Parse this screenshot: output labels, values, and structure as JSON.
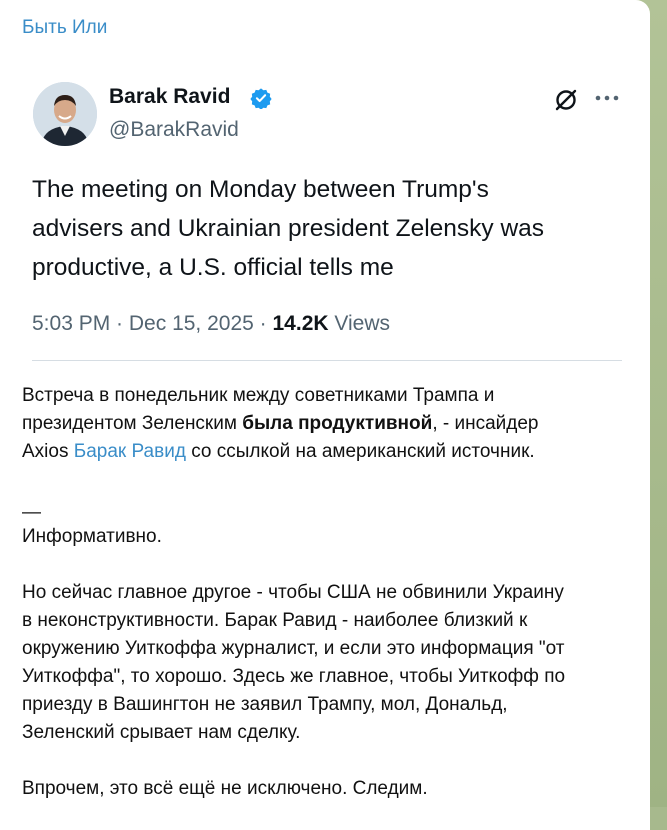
{
  "channel": {
    "name": "Быть Или"
  },
  "tweet": {
    "author_name": "Barak Ravid",
    "handle": "@BarakRavid",
    "text_lines": [
      "The meeting on Monday between Trump's",
      "advisers and Ukrainian president Zelensky was",
      "productive, a U.S. official tells me"
    ],
    "time": "5:03 PM",
    "sep1": " · ",
    "date": "Dec 15, 2025",
    "sep2": " · ",
    "views_count": "14.2K",
    "views_label": " Views"
  },
  "message": {
    "p1_line1": "Встреча в понедельник между советниками Трампа и",
    "p1_line2_a": "президентом Зеленским ",
    "p1_line2_bold": "была продуктивной",
    "p1_line2_b": ", - инсайдер",
    "p1_line3_a": "Axios ",
    "p1_line3_link": "Барак Равид",
    "p1_line3_b": " со ссылкой на американский источник.",
    "dash": "—",
    "informative": "Информативно.",
    "p3_lines": [
      "Но сейчас главное другое - чтобы США не обвинили Украину",
      "в неконструктивности. Барак Равид - наиболее близкий к",
      "окружению Уиткоффа журналист, и если это информация \"от",
      "Уиткоффа\", то хорошо. Здесь же главное, чтобы Уиткофф по",
      "приезду в Вашингтон не заявил Трампу, мол, Дональд,",
      "Зеленский срывает нам сделку."
    ],
    "p4": "Впрочем, это всё ещё не исключено. Следим."
  },
  "colors": {
    "link": "#3a8dc8",
    "verified": "#1d9bf0",
    "wallpaper": "#a7b98d"
  },
  "icons": {
    "verified": "verified-badge-icon",
    "grok": "grok-icon",
    "more": "more-horizontal-icon"
  }
}
